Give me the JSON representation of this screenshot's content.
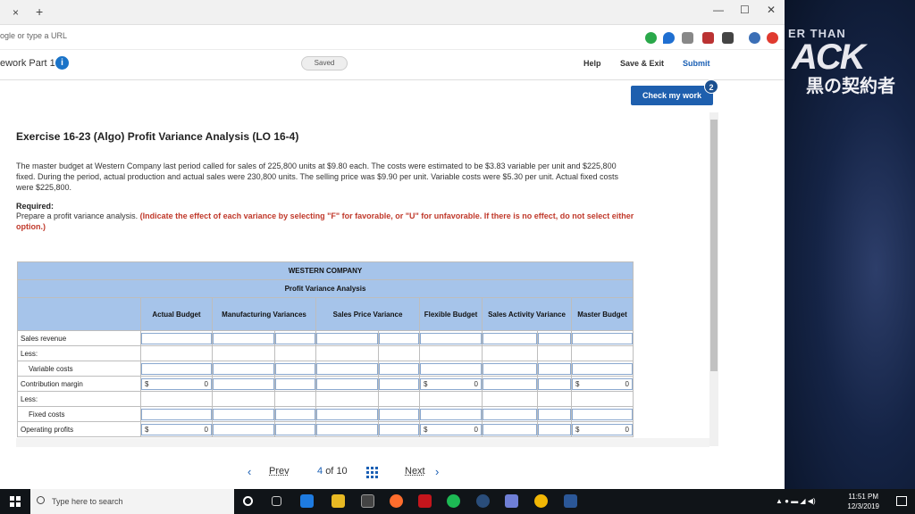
{
  "browser": {
    "url_placeholder": "ogle or type a URL",
    "add_tab": "+",
    "close_tab": "×",
    "minimize": "—",
    "maximize": "☐",
    "close_window": "✕"
  },
  "wallpaper": {
    "line1": "ER THAN",
    "line2": "ACK",
    "line3": "黒の契約者"
  },
  "app_header": {
    "title": "ework Part 1",
    "info": "i",
    "saved": "Saved",
    "help": "Help",
    "save_exit": "Save & Exit",
    "submit": "Submit"
  },
  "check": {
    "label": "Check my work",
    "badge": "2"
  },
  "exercise": {
    "title": "Exercise 16-23 (Algo) Profit Variance Analysis (LO 16-4)",
    "problem": "The master budget at Western Company last period called for sales of 225,800 units at $9.80 each. The costs were estimated to be $3.83 variable per unit and $225,800 fixed. During the period, actual production and actual sales were 230,800 units. The selling price was $9.90 per unit. Variable costs were $5.30 per unit. Actual fixed costs were $225,800.",
    "required_label": "Required:",
    "required_text": "Prepare a profit variance analysis. ",
    "required_red": "(Indicate the effect of each variance by selecting \"F\" for favorable, or \"U\" for unfavorable. If there is no effect, do not select either option.)"
  },
  "table": {
    "company": "WESTERN COMPANY",
    "subtitle": "Profit Variance Analysis",
    "columns": [
      "Actual Budget",
      "Manufacturing Variances",
      "Sales Price Variance",
      "Flexible Budget",
      "Sales Activity Variance",
      "Master Budget"
    ],
    "rows": {
      "sales_revenue": "Sales revenue",
      "less1": "Less:",
      "variable_costs": "Variable costs",
      "contribution_margin": "Contribution margin",
      "less2": "Less:",
      "fixed_costs": "Fixed costs",
      "operating_profits": "Operating profits"
    },
    "currency": "$",
    "zero": "0"
  },
  "pager": {
    "prev": "Prev",
    "page": "4",
    "of": "of",
    "total": "10",
    "next": "Next"
  },
  "taskbar": {
    "search": "Type here to search",
    "time": "11:51 PM",
    "date": "12/3/2019"
  },
  "colors": {
    "accent": "#1e5fae",
    "table_header": "#a6c4ea",
    "required_red": "#c0392b"
  }
}
